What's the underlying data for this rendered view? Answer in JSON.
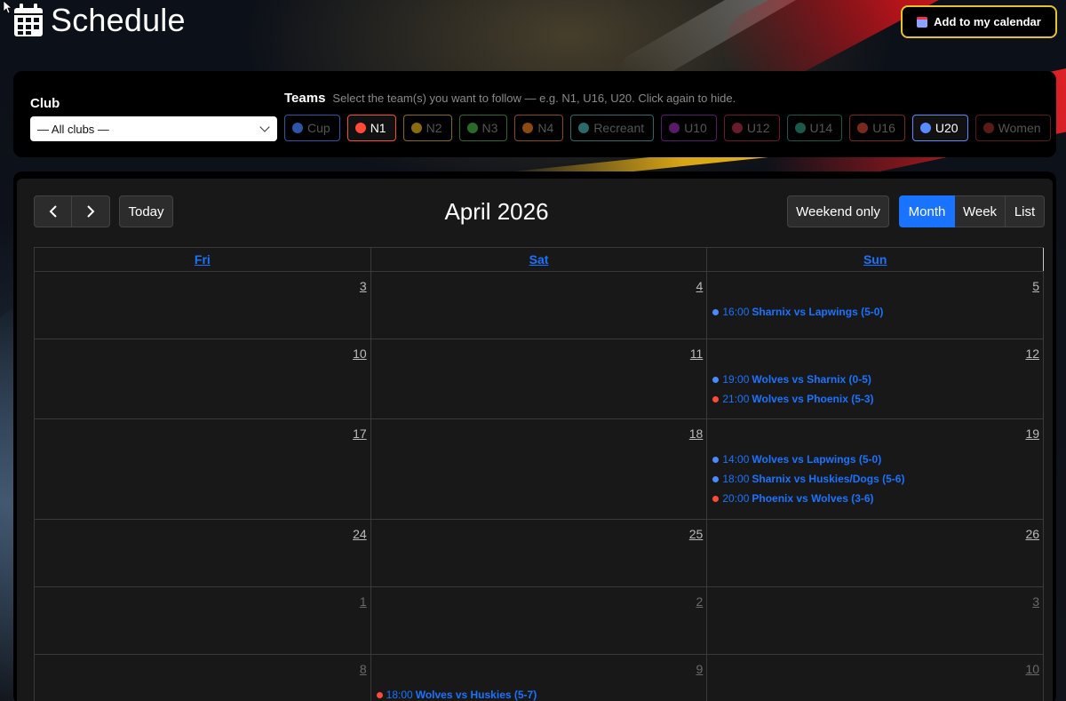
{
  "header": {
    "title": "Schedule",
    "add_calendar_label": "Add to my calendar"
  },
  "filters": {
    "club_label": "Club",
    "club_selected": "— All clubs —",
    "teams_label": "Teams",
    "teams_hint": "Select the team(s) you want to follow — e.g. N1, U16, U20. Click again to hide.",
    "chips": [
      {
        "label": "Cup",
        "color": "#2e56a8",
        "active": false
      },
      {
        "label": "N1",
        "color": "#ff4a3a",
        "active": true
      },
      {
        "label": "N2",
        "color": "#8a6a12",
        "active": false
      },
      {
        "label": "N3",
        "color": "#2a6a2a",
        "active": false
      },
      {
        "label": "N4",
        "color": "#8a4a12",
        "active": false
      },
      {
        "label": "Recreant",
        "color": "#2a6a6a",
        "active": false
      },
      {
        "label": "U10",
        "color": "#5a1a6a",
        "active": false
      },
      {
        "label": "U12",
        "color": "#6a1a2a",
        "active": false
      },
      {
        "label": "U14",
        "color": "#1a5a4a",
        "active": false
      },
      {
        "label": "U16",
        "color": "#7a2a1a",
        "active": false
      },
      {
        "label": "U20",
        "color": "#5a8aff",
        "active": true
      },
      {
        "label": "Women",
        "color": "#5a1a1a",
        "active": false
      }
    ]
  },
  "calendar": {
    "month_title": "April 2026",
    "today_label": "Today",
    "weekend_label": "Weekend only",
    "views": [
      {
        "label": "Month",
        "active": true
      },
      {
        "label": "Week",
        "active": false
      },
      {
        "label": "List",
        "active": false
      }
    ],
    "day_headers": [
      "Fri",
      "Sat",
      "Sun"
    ],
    "weeks": [
      [
        {
          "num": "3",
          "other": false,
          "events": []
        },
        {
          "num": "4",
          "other": false,
          "events": []
        },
        {
          "num": "5",
          "other": false,
          "events": [
            {
              "time": "16:00",
              "title": "Sharnix vs Lapwings (5-0)",
              "color": "#4a8aff"
            }
          ]
        }
      ],
      [
        {
          "num": "10",
          "other": false,
          "events": []
        },
        {
          "num": "11",
          "other": false,
          "events": []
        },
        {
          "num": "12",
          "other": false,
          "events": [
            {
              "time": "19:00",
              "title": "Wolves vs Sharnix (0-5)",
              "color": "#4a8aff"
            },
            {
              "time": "21:00",
              "title": "Wolves vs Phoenix (5-3)",
              "color": "#ff4a3a"
            }
          ]
        }
      ],
      [
        {
          "num": "17",
          "other": false,
          "events": []
        },
        {
          "num": "18",
          "other": false,
          "events": []
        },
        {
          "num": "19",
          "other": false,
          "events": [
            {
              "time": "14:00",
              "title": "Wolves vs Lapwings (5-0)",
              "color": "#4a8aff"
            },
            {
              "time": "18:00",
              "title": "Sharnix vs Huskies/Dogs (5-6)",
              "color": "#4a8aff"
            },
            {
              "time": "20:00",
              "title": "Phoenix vs Wolves (3-6)",
              "color": "#ff4a3a"
            }
          ]
        }
      ],
      [
        {
          "num": "24",
          "other": false,
          "events": []
        },
        {
          "num": "25",
          "other": false,
          "events": []
        },
        {
          "num": "26",
          "other": false,
          "events": []
        }
      ],
      [
        {
          "num": "1",
          "other": true,
          "events": []
        },
        {
          "num": "2",
          "other": true,
          "events": []
        },
        {
          "num": "3",
          "other": true,
          "events": []
        }
      ],
      [
        {
          "num": "8",
          "other": true,
          "events": []
        },
        {
          "num": "9",
          "other": true,
          "events": [
            {
              "time": "18:00",
              "title": "Wolves vs Huskies (5-7)",
              "color": "#ff4a3a"
            }
          ]
        },
        {
          "num": "10",
          "other": true,
          "events": []
        }
      ]
    ]
  }
}
